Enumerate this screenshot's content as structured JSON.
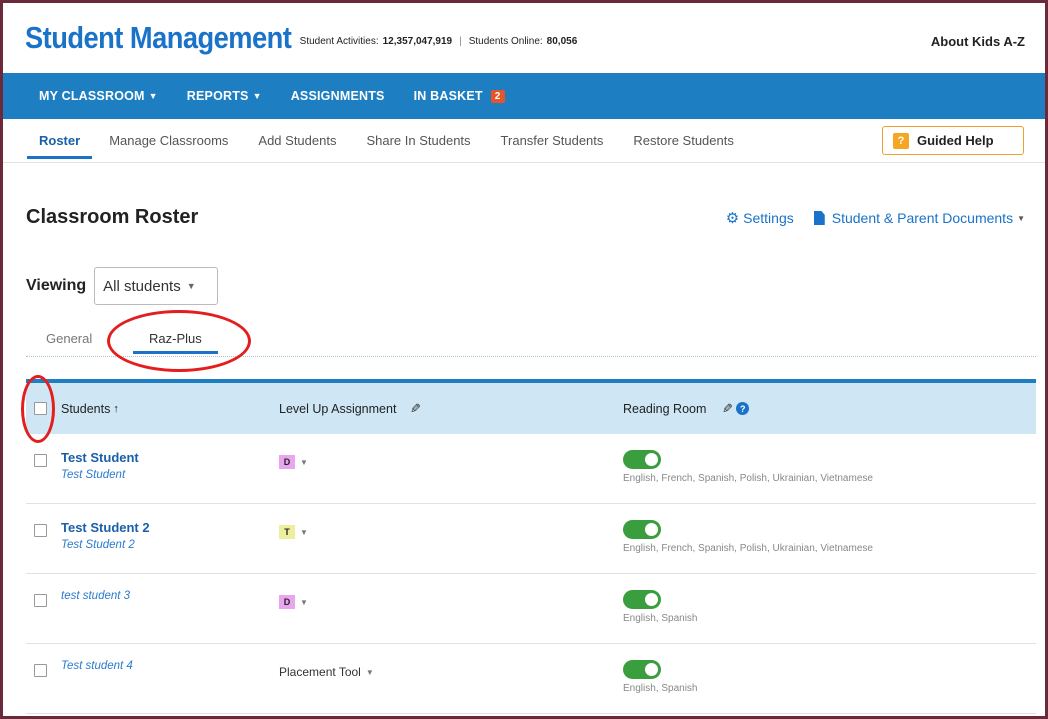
{
  "header": {
    "title": "Student Management",
    "stats_activities_label": "Student Activities:",
    "stats_activities_value": "12,357,047,919",
    "stats_online_label": "Students Online:",
    "stats_online_value": "80,056",
    "about_label": "About Kids A-Z"
  },
  "nav": {
    "my_classroom": "MY CLASSROOM",
    "reports": "REPORTS",
    "assignments": "ASSIGNMENTS",
    "in_basket": "IN BASKET",
    "in_basket_count": "2"
  },
  "subnav": {
    "items": [
      "Roster",
      "Manage Classrooms",
      "Add Students",
      "Share In Students",
      "Transfer Students",
      "Restore Students"
    ],
    "guided_help": "Guided Help",
    "guided_help_icon": "?"
  },
  "page": {
    "title": "Classroom Roster",
    "settings": "Settings",
    "documents": "Student & Parent Documents",
    "viewing_label": "Viewing",
    "viewing_value": "All students"
  },
  "tabs": {
    "general": "General",
    "raz_plus": "Raz-Plus"
  },
  "table": {
    "headers": {
      "students": "Students",
      "sort_arrow": "↑",
      "level_up": "Level Up Assignment",
      "reading_room": "Reading Room",
      "help_icon": "?"
    },
    "rows": [
      {
        "name": "Test Student",
        "username": "Test Student",
        "level": "D",
        "level_color": "#e9a6ef",
        "languages": "English, French, Spanish, Polish, Ukrainian, Vietnamese"
      },
      {
        "name": "Test Student 2",
        "username": "Test Student 2",
        "level": "T",
        "level_color": "#eeef9e",
        "languages": "English, French, Spanish, Polish, Ukrainian, Vietnamese"
      },
      {
        "name": "test student 3",
        "level": "D",
        "level_color": "#e9a6ef",
        "languages": "English, Spanish"
      },
      {
        "name": "Test student 4",
        "level": "Placement Tool",
        "languages": "English, Spanish"
      }
    ]
  },
  "colors": {
    "brand_blue": "#1d7fc1",
    "toggle_green": "#3a9e3e",
    "annotation_red": "#e41d1d",
    "badge_orange": "#e8542a"
  }
}
